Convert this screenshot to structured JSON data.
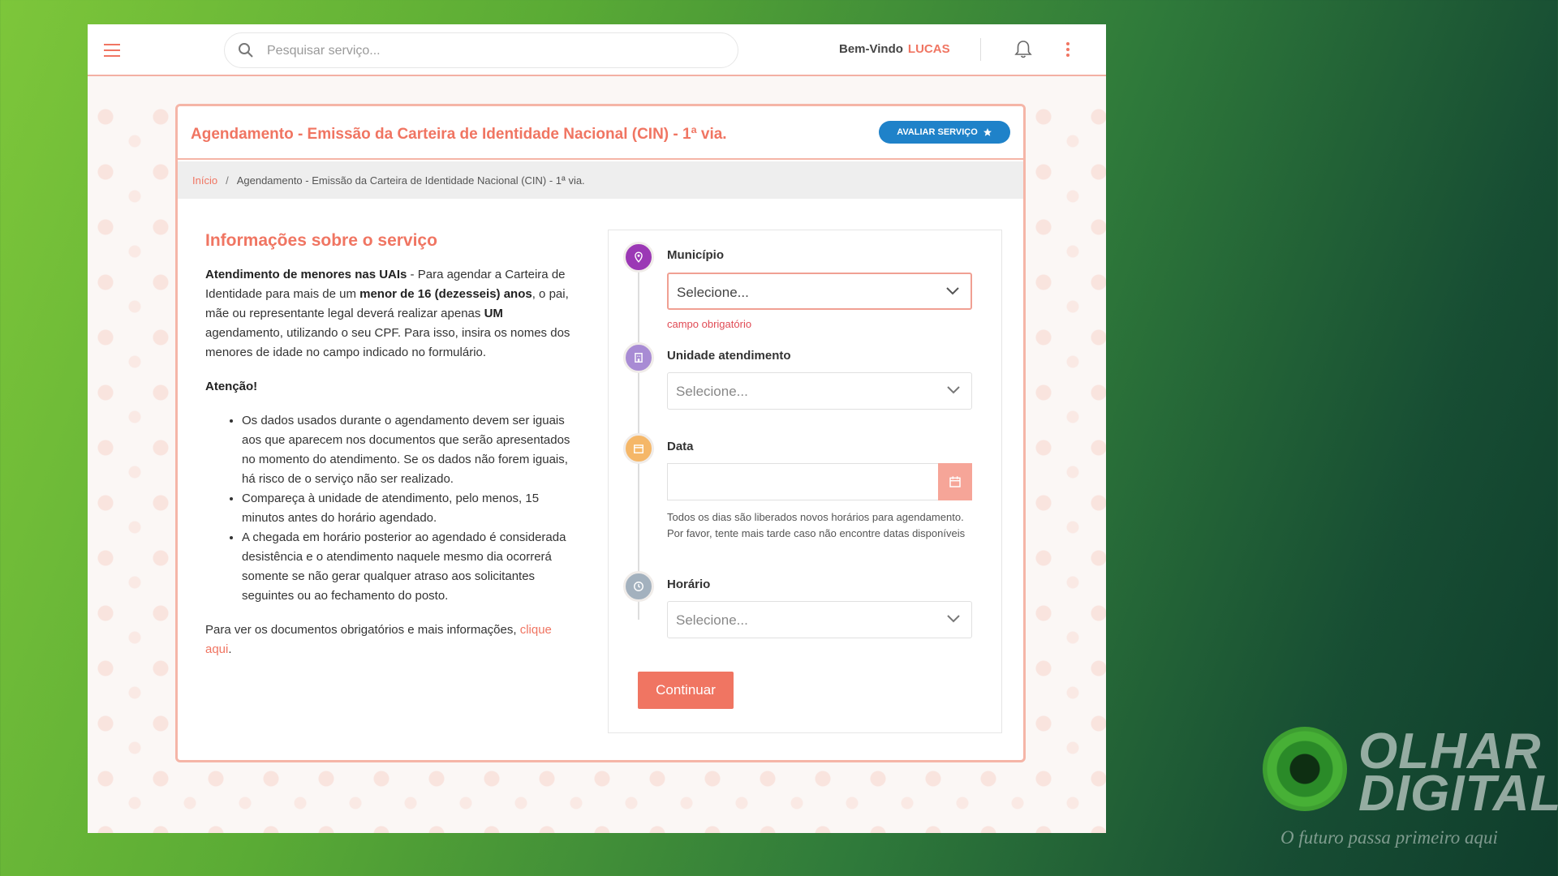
{
  "topbar": {
    "search_placeholder": "Pesquisar serviço...",
    "welcome_label": "Bem-Vindo",
    "username": "LUCAS"
  },
  "card": {
    "title": "Agendamento - Emissão da Carteira de Identidade Nacional (CIN) - 1ª via.",
    "rate_button": "AVALIAR SERVIÇO",
    "breadcrumb": {
      "home": "Início",
      "current": "Agendamento - Emissão da Carteira de Identidade Nacional (CIN) - 1ª via."
    }
  },
  "info": {
    "heading": "Informações sobre o serviço",
    "p1_bold": "Atendimento de menores nas UAIs",
    "p1_text1": " - Para agendar a Carteira de Identidade para mais de um ",
    "p1_bold2": "menor de 16 (dezesseis) anos",
    "p1_text2": ", o pai, mãe ou representante legal deverá realizar apenas ",
    "p1_bold3": "UM",
    "p1_text3": " agendamento, utilizando o seu CPF. Para isso, insira os nomes dos menores de idade no campo indicado no formulário.",
    "attention": "Atenção!",
    "bullets": [
      "Os dados usados durante o agendamento devem ser iguais aos que aparecem nos documentos que serão apresentados no momento do atendimento. Se os dados não forem iguais, há risco de o serviço não ser realizado.",
      "Compareça à unidade de atendimento, pelo menos, 15 minutos antes do horário agendado.",
      "A chegada em horário posterior ao agendado é considerada desistência e o atendimento naquele mesmo dia ocorrerá somente se não gerar qualquer atraso aos solicitantes seguintes ou ao fechamento do posto."
    ],
    "footer_text": "Para ver os documentos obrigatórios e mais informações, ",
    "footer_link": "clique aqui",
    "footer_end": "."
  },
  "form": {
    "municipio": {
      "label": "Município",
      "value": "Selecione...",
      "error": "campo obrigatório"
    },
    "unidade": {
      "label": "Unidade atendimento",
      "value": "Selecione..."
    },
    "data": {
      "label": "Data",
      "value": "",
      "help": "Todos os dias são liberados novos horários para agendamento. Por favor, tente mais tarde caso não encontre datas disponíveis"
    },
    "horario": {
      "label": "Horário",
      "value": "Selecione..."
    },
    "continue_button": "Continuar"
  },
  "watermark": {
    "line1": "OLHAR",
    "line2": "DIGITAL",
    "tagline": "O futuro passa primeiro aqui"
  },
  "colors": {
    "accent": "#f07562",
    "button_blue": "#1f82c9",
    "step_municipio": "#9b38b5",
    "step_unidade": "#a88bd4",
    "step_data": "#f5b768",
    "step_horario": "#a3b1be"
  }
}
